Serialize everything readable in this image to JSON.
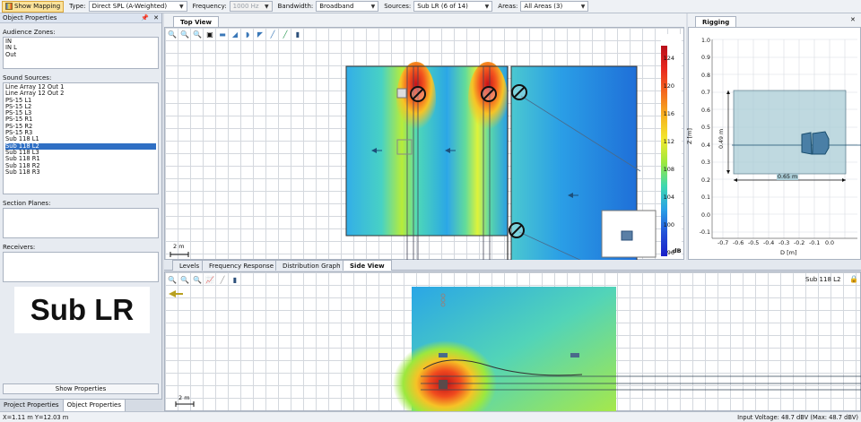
{
  "toolbar": {
    "show_mapping": "Show Mapping",
    "type_label": "Type:",
    "type_value": "Direct SPL (A-Weighted)",
    "frequency_label": "Frequency:",
    "frequency_value": "1000 Hz",
    "bandwidth_label": "Bandwidth:",
    "bandwidth_value": "Broadband",
    "sources_label": "Sources:",
    "sources_value": "Sub LR (6 of 14)",
    "areas_label": "Areas:",
    "areas_value": "All Areas (3)"
  },
  "left_panel": {
    "title": "Object Properties",
    "pin_icon": "pin-icon",
    "close_icon": "close-icon",
    "audience_zones_label": "Audience Zones:",
    "audience_zones": [
      "IN",
      "IN L",
      "Out"
    ],
    "sound_sources_label": "Sound Sources:",
    "sound_sources": [
      "Line Array 12 Out 1",
      "Line Array 12 Out 2",
      "PS-15 L1",
      "PS-15 L2",
      "PS-15 L3",
      "PS-15 R1",
      "PS-15 R2",
      "PS-15 R3",
      "Sub 118 L1",
      "Sub 118 L2",
      "Sub 118 L3",
      "Sub 118 R1",
      "Sub 118 R2",
      "Sub 118 R3"
    ],
    "selected_source": "Sub 118 L2",
    "section_planes_label": "Section Planes:",
    "receivers_label": "Receivers:",
    "big_label": "Sub LR",
    "show_properties": "Show Properties",
    "bottom_tabs": [
      "Project Properties",
      "Object Properties"
    ]
  },
  "top_view": {
    "tab": "Top View",
    "scale_label": "2 m",
    "colorbar_ticks": [
      "124",
      "120",
      "116",
      "112",
      "108",
      "104",
      "100",
      "96"
    ],
    "colorbar_unit": "dB"
  },
  "rigging": {
    "tab": "Rigging",
    "close_icon": "close-icon",
    "y_ticks": [
      "1.0",
      "0.9",
      "0.8",
      "0.7",
      "0.6",
      "0.5",
      "0.4",
      "0.3",
      "0.2",
      "0.1",
      "0.0",
      "-0.1"
    ],
    "x_ticks": [
      "-0.7",
      "-0.6",
      "-0.5",
      "-0.4",
      "-0.3",
      "-0.2",
      "-0.1",
      "0.0"
    ],
    "y_axis_label": "Z [m]",
    "x_axis_label": "D [m]",
    "dim_height": "0.49 m",
    "dim_width": "0.65 m"
  },
  "bottom_view": {
    "tabs": [
      "Levels",
      "Frequency Response",
      "Distribution Graph",
      "Side View"
    ],
    "active_tab": "Side View",
    "selection_label": "Sub 118 L2",
    "lock_icon": "lock-icon",
    "scale_label": "2 m"
  },
  "status": {
    "coords": "X=1.11 m Y=12.03 m",
    "voltage": "Input Voltage: 48.7 dBV (Max: 48.7 dBV)"
  }
}
